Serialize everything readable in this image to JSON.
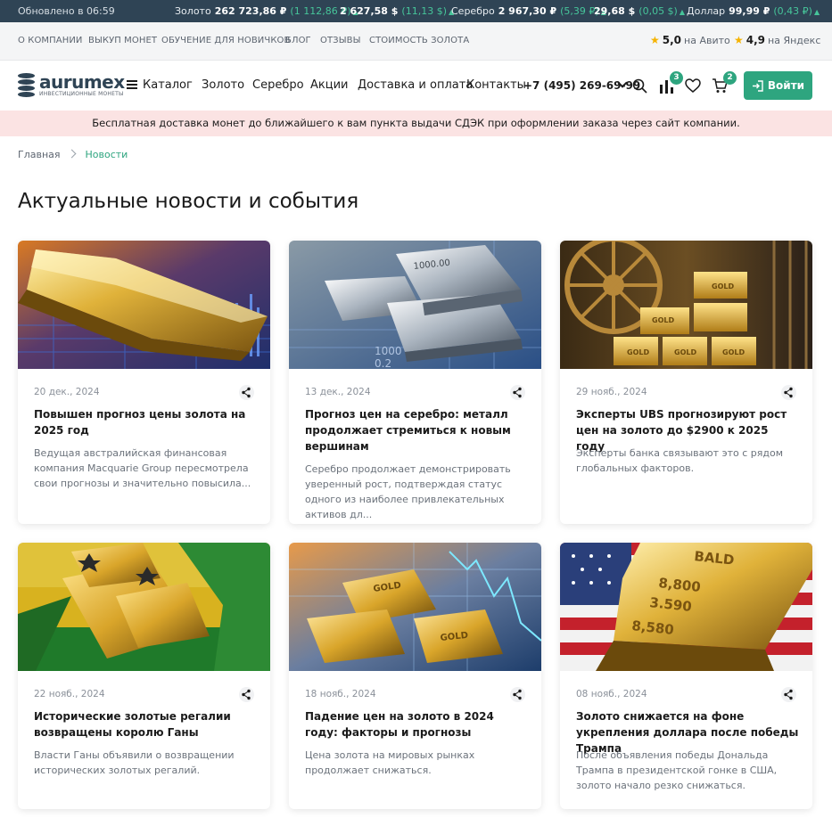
{
  "ticker": {
    "updated": "Обновлено в 06:59",
    "items": [
      {
        "name": "Золото",
        "price": "262 723,86 ₽",
        "change": "(1 112,86 ₽)"
      },
      {
        "name": "",
        "price": "2 627,58 $",
        "change": "(11,13 $)"
      },
      {
        "name": "Серебро",
        "price": "2 967,30 ₽",
        "change": "(5,39 ₽)"
      },
      {
        "name": "",
        "price": "29,68 $",
        "change": "(0,05 $)"
      },
      {
        "name": "Доллар",
        "price": "99,99 ₽",
        "change": "(0,43 ₽)"
      }
    ],
    "up_color": "#46c59a"
  },
  "toplinks": {
    "items": [
      "О КОМПАНИИ",
      "ВЫКУП МОНЕТ",
      "ОБУЧЕНИЕ ДЛЯ НОВИЧКОВ",
      "БЛОГ",
      "ОТЗЫВЫ",
      "СТОИМОСТЬ ЗОЛОТА"
    ],
    "ratings": [
      {
        "value": "5,0",
        "source": "на Авито"
      },
      {
        "value": "4,9",
        "source": "на Яндекс"
      }
    ]
  },
  "header": {
    "logo": {
      "brand": "aurumex",
      "tagline": "ИНВЕСТИЦИОННЫЕ МОНЕТЫ"
    },
    "catalog": "Каталог",
    "nav": [
      "Золото",
      "Серебро",
      "Акции",
      "Доставка и оплата",
      "Контакты"
    ],
    "phone": "+7 (495) 269-69-99",
    "compare_count": "3",
    "cart_count": "2",
    "login": "Войти",
    "accent": "#2ea57f"
  },
  "promo": "Бесплатная доставка монет до ближайшего к вам пункта выдачи СДЭК при оформлении заказа через сайт компании.",
  "breadcrumb": {
    "home": "Главная",
    "current": "Новости"
  },
  "page_title": "Актуальные новости и события",
  "news": [
    {
      "date": "20 дек., 2024",
      "title": "Повышен прогноз цены золота на 2025 год",
      "desc": "Ведущая австралийская финансовая компания Macquarie Group пересмотрела свои прогнозы и значительно повысила...",
      "image": "gold-bar-on-chart"
    },
    {
      "date": "13 дек., 2024",
      "title": "Прогноз цен на серебро: металл продолжает стремиться к новым вершинам",
      "desc": "Серебро продолжает демонстрировать уверенный рост, подтверждая статус одного из наиболее привлекательных активов дл...",
      "image": "silver-bars-on-chart"
    },
    {
      "date": "29 нояб., 2024",
      "title": "Эксперты UBS прогнозируют рост цен на золото до $2900 к 2025 году",
      "desc": "Эксперты банка связывают это с рядом глобальных факторов.",
      "image": "gold-bars-in-vault"
    },
    {
      "date": "22 нояб., 2024",
      "title": "Исторические золотые регалии возвращены королю Ганы",
      "desc": "Власти Ганы объявили о возвращении исторических золотых регалий.",
      "image": "gold-bars-ghana-flag"
    },
    {
      "date": "18 нояб., 2024",
      "title": "Падение цен на золото в 2024 году: факторы и прогнозы",
      "desc": "Цена золота на мировых рынках продолжает снижаться.",
      "image": "gold-bars-falling-chart"
    },
    {
      "date": "08 нояб., 2024",
      "title": "Золото снижается на фоне укрепления доллара после победы Трампа",
      "desc": "После объявления победы Дональда Трампа в президентской гонке в США, золото начало резко снижаться.",
      "image": "gold-bars-us-flag"
    }
  ]
}
